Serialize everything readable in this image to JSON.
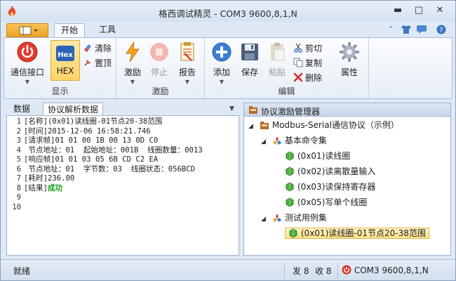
{
  "window": {
    "title": "格西调试精灵 - COM3  9600,8,1,N"
  },
  "ribbon": {
    "tabs": [
      "开始",
      "工具"
    ],
    "groups": {
      "display": {
        "label": "显示",
        "com_port": "通信接口",
        "hex": "HEX",
        "clear": "清除",
        "pin": "置顶"
      },
      "stimulus": {
        "label": "激励",
        "stimulus": "激励",
        "stop": "停止",
        "report": "报告"
      },
      "edit": {
        "label": "编辑",
        "add": "添加",
        "save": "保存",
        "paste": "粘贴",
        "cut": "剪切",
        "copy": "复制",
        "delete": "删除",
        "properties": "属性"
      }
    }
  },
  "left_pane": {
    "tabs": [
      "数据",
      "协议解析数据"
    ],
    "lines": [
      {
        "n": "1",
        "text": "[名称](0x01)读线圈-01节点20-38范围"
      },
      {
        "n": "2",
        "text": "[时间]2015-12-06 16:58:21.746"
      },
      {
        "n": "3",
        "text": "[请求帧]01 01 00 1B 00 13 0D C0"
      },
      {
        "n": "4",
        "text": " 节点地址：01  起始地址：001B  线圈数量：0013"
      },
      {
        "n": "5",
        "text": "[响应帧]01 01 03 05 6B CD C2 EA"
      },
      {
        "n": "6",
        "text": " 节点地址：01  字节数：03  线圈状态：056BCD"
      },
      {
        "n": "7",
        "text": "[耗时]236.00"
      },
      {
        "n": "8",
        "text": "[结果]",
        "extra": "成功"
      },
      {
        "n": "9",
        "text": ""
      },
      {
        "n": "10",
        "text": ""
      }
    ]
  },
  "right_pane": {
    "title": "协议激励管理器",
    "root": "Modbus-Serial通信协议（示例）",
    "group_basic": "基本命令集",
    "basic_items": [
      "(0x01)读线圈",
      "(0x02)读离散量输入",
      "(0x03)读保持寄存器",
      "(0x05)写单个线圈"
    ],
    "group_test": "测试用例集",
    "test_items": [
      "(0x01)读线圈-01节点20-38范围"
    ]
  },
  "status": {
    "ready": "就绪",
    "sent": "发 8",
    "received": "收 8",
    "port": "COM3  9600,8,1,N"
  },
  "colors": {
    "accent": "#f0a830",
    "success": "#1a9b1a",
    "selection": "#ffe38a",
    "port_icon": "#d93025"
  }
}
